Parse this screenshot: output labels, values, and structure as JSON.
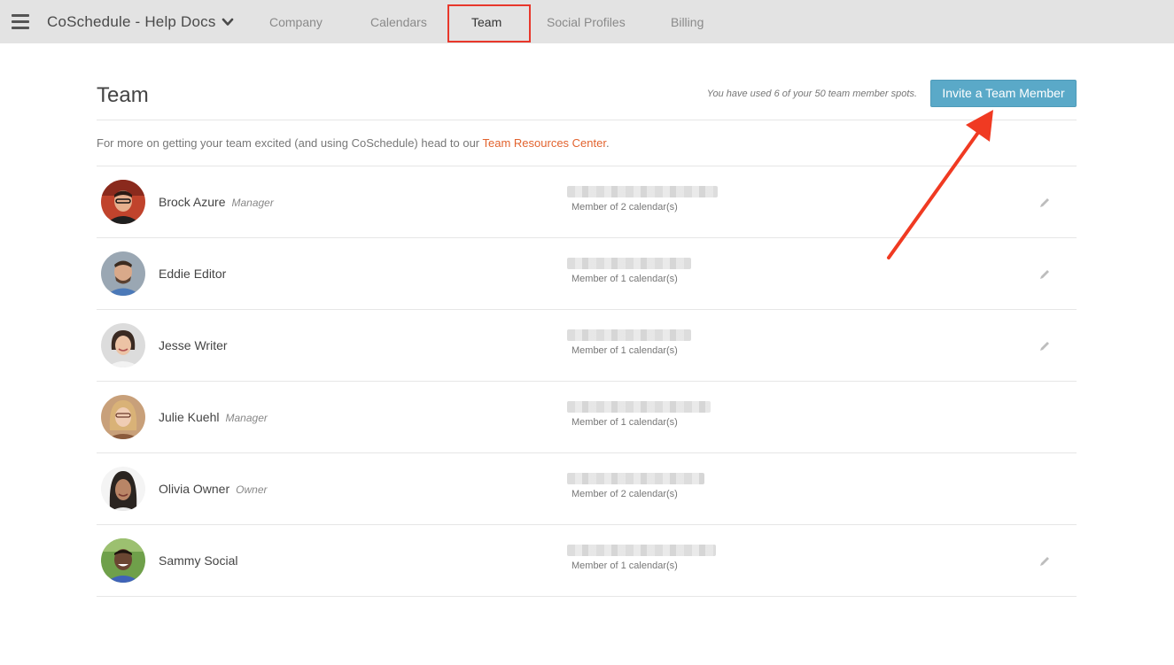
{
  "header": {
    "workspace_name": "CoSchedule - Help Docs",
    "tabs": [
      {
        "label": "Company"
      },
      {
        "label": "Calendars"
      },
      {
        "label": "Team"
      },
      {
        "label": "Social Profiles"
      },
      {
        "label": "Billing"
      }
    ],
    "active_tab": "Team"
  },
  "page": {
    "title": "Team",
    "spots_text": "You have used 6 of your 50 team member spots.",
    "invite_button": "Invite a Team Member",
    "intro_text": "For more on getting your team excited (and using CoSchedule) head to our ",
    "intro_link": "Team Resources Center",
    "intro_end": "."
  },
  "members": [
    {
      "name": "Brock Azure",
      "role": "Manager",
      "calendars": "Member of 2 calendar(s)",
      "editable": true
    },
    {
      "name": "Eddie Editor",
      "role": "",
      "calendars": "Member of 1 calendar(s)",
      "editable": true
    },
    {
      "name": "Jesse Writer",
      "role": "",
      "calendars": "Member of 1 calendar(s)",
      "editable": true
    },
    {
      "name": "Julie Kuehl",
      "role": "Manager",
      "calendars": "Member of 1 calendar(s)",
      "editable": false
    },
    {
      "name": "Olivia Owner",
      "role": "Owner",
      "calendars": "Member of 2 calendar(s)",
      "editable": false
    },
    {
      "name": "Sammy Social",
      "role": "",
      "calendars": "Member of 1 calendar(s)",
      "editable": true
    }
  ],
  "colors": {
    "accent_button": "#5aa9c8",
    "link": "#e2632e",
    "annotation": "#f03a22"
  }
}
